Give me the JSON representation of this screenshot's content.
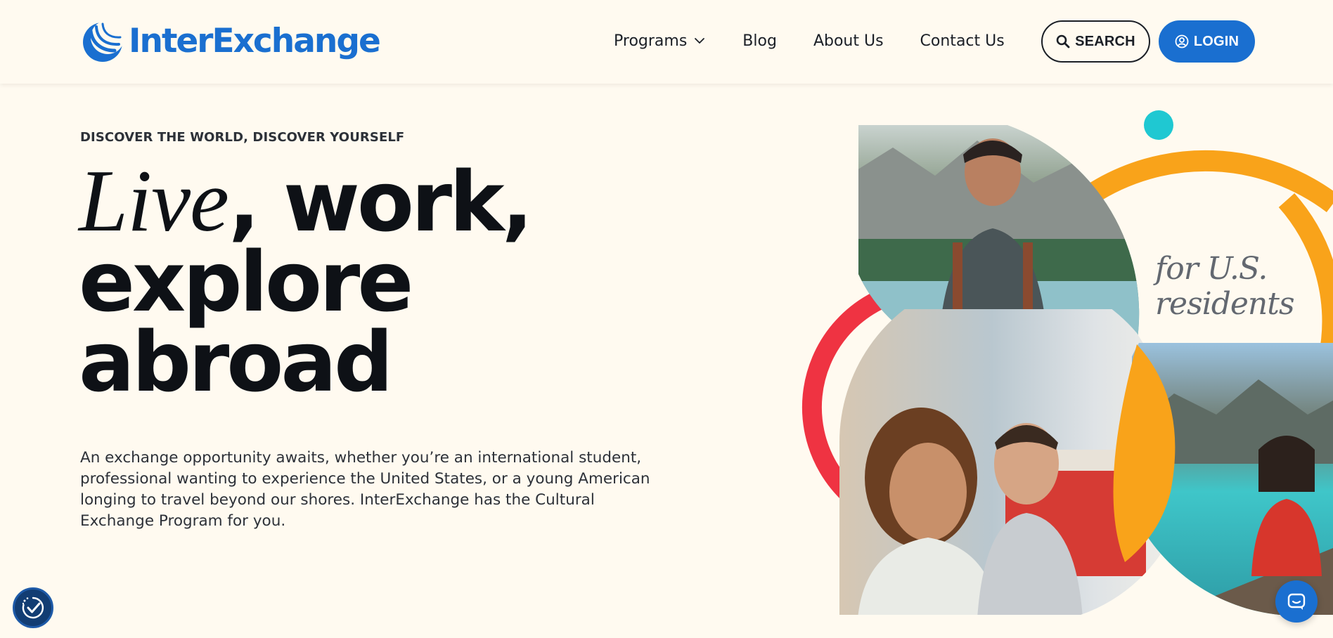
{
  "brand": {
    "name": "InterExchange",
    "logo_icon": "crescent-waves-icon",
    "color": "#1a6fd0"
  },
  "nav": {
    "items": [
      {
        "label": "Programs",
        "has_dropdown": true
      },
      {
        "label": "Blog",
        "has_dropdown": false
      },
      {
        "label": "About Us",
        "has_dropdown": false
      },
      {
        "label": "Contact Us",
        "has_dropdown": false
      }
    ]
  },
  "header_actions": {
    "search_label": "SEARCH",
    "search_icon": "search-icon",
    "login_label": "LOGIN",
    "login_icon": "user-circle-icon"
  },
  "hero": {
    "eyebrow": "DISCOVER THE WORLD, DISCOVER YOURSELF",
    "headline": {
      "italic_word": "Live",
      "line1_rest": ", work,",
      "line2": "explore",
      "line3": "abroad"
    },
    "description": "An exchange opportunity awaits, whether you’re an international student, professional wanting to experience the United States, or a young American longing to travel beyond our shores. InterExchange has the Cultural Exchange Program for you.",
    "tagline_line1": "for U.S.",
    "tagline_line2": "residents",
    "photos": [
      {
        "subject": "smiling hiker with backpack by mountain river"
      },
      {
        "subject": "two smiling travelers near a red tram"
      },
      {
        "subject": "woman in life jacket in a boat on a turquoise lake"
      }
    ],
    "accent_colors": {
      "orange": "#f9a31a",
      "red": "#ef3342",
      "teal": "#1fc8d2"
    }
  },
  "widgets": {
    "accessibility_icon": "accessibility-check-icon",
    "chat_icon": "chat-bubble-icon"
  }
}
